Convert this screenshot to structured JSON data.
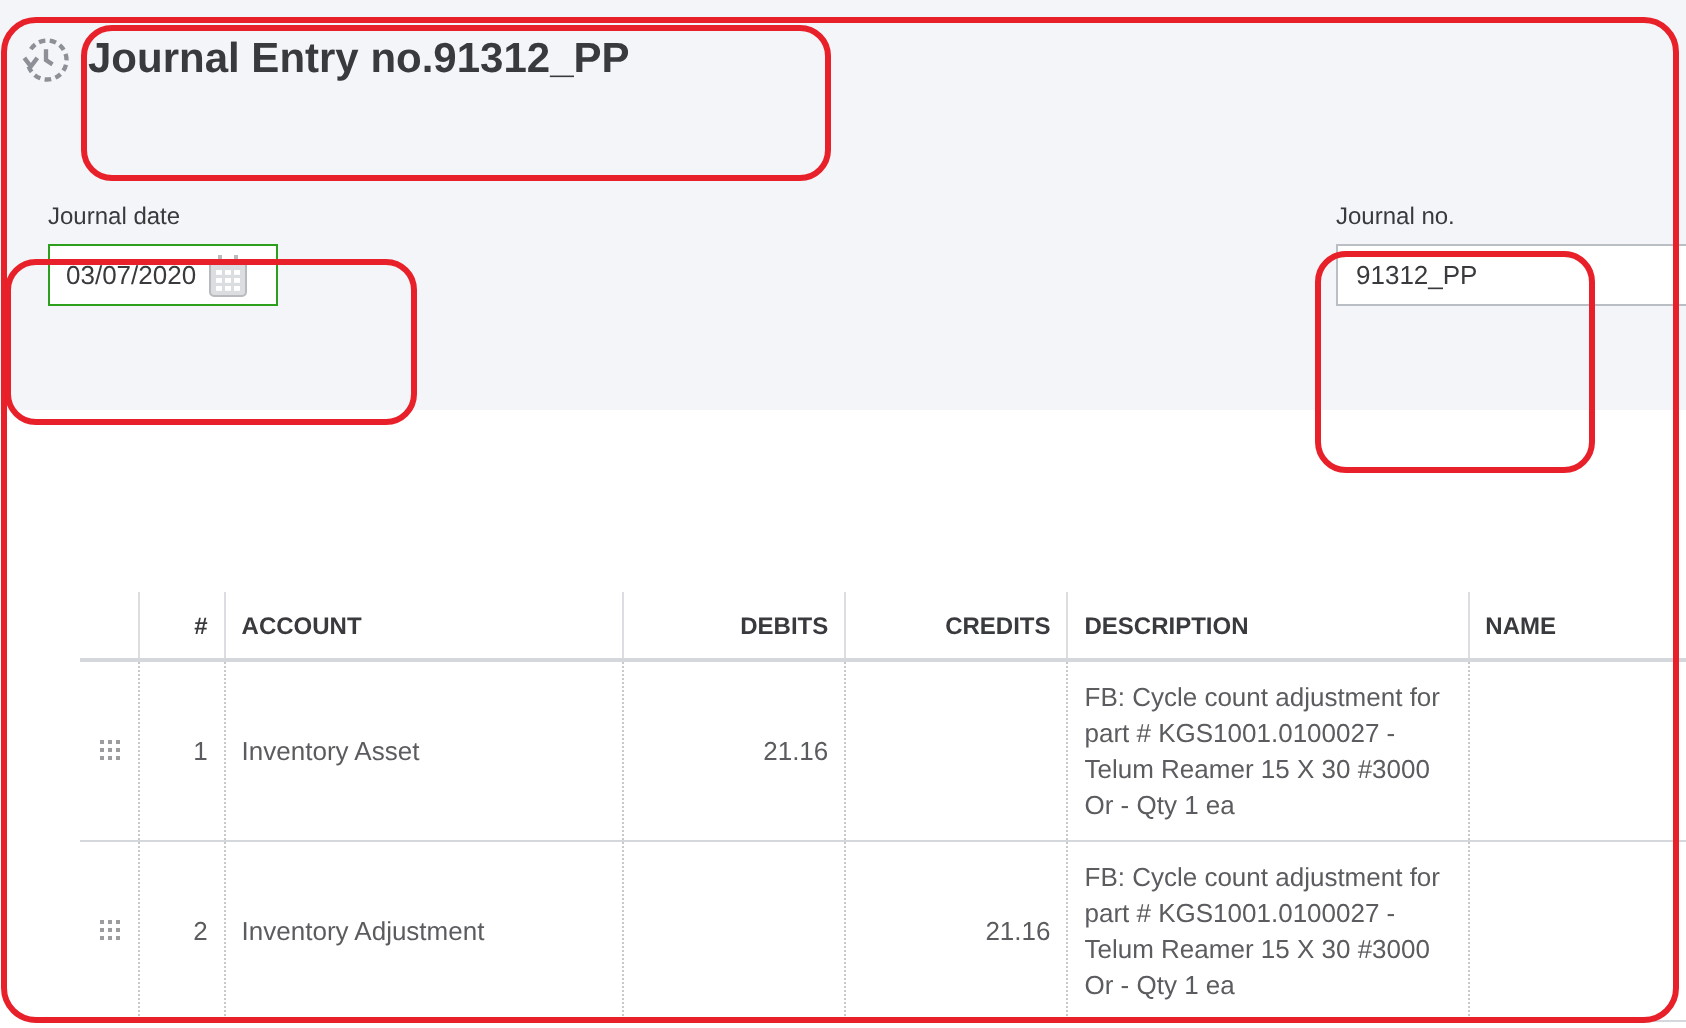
{
  "title": "Journal Entry no.91312_PP",
  "journal_date": {
    "label": "Journal date",
    "value": "03/07/2020"
  },
  "journal_no": {
    "label": "Journal no.",
    "value": "91312_PP"
  },
  "table": {
    "columns": [
      "#",
      "ACCOUNT",
      "DEBITS",
      "CREDITS",
      "DESCRIPTION",
      "NAME"
    ],
    "rows": [
      {
        "number": "1",
        "account": "Inventory Asset",
        "debits": "21.16",
        "description": "FB: Cycle count adjustment for part # KGS1001.0100027 - Telum Reamer 15 X 30 #3000 Or - Qty 1 ea"
      },
      {
        "number": "2",
        "account": "Inventory Adjustment",
        "credits": "21.16",
        "description": "FB: Cycle count adjustment for part # KGS1001.0100027 - Telum Reamer 15 X 30 #3000 Or - Qty 1 ea"
      }
    ]
  }
}
